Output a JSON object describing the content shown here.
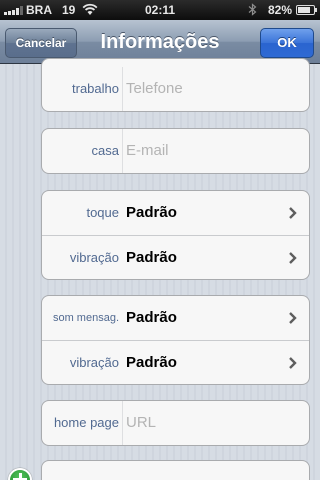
{
  "status_bar": {
    "carrier": "BRA",
    "network": "19",
    "time": "02:11",
    "battery": "82%",
    "battery_level": 0.82
  },
  "nav": {
    "title": "Informações",
    "cancel_label": "Cancelar",
    "ok_label": "OK"
  },
  "fields": {
    "work_phone": {
      "label": "trabalho",
      "placeholder": "Telefone"
    },
    "home_email": {
      "label": "casa",
      "placeholder": "E-mail"
    },
    "ringtone": {
      "label": "toque",
      "value": "Padrão"
    },
    "ring_vibration": {
      "label": "vibração",
      "value": "Padrão"
    },
    "text_tone": {
      "label": "som mensag.",
      "value": "Padrão"
    },
    "text_vibration": {
      "label": "vibração",
      "value": "Padrão"
    },
    "homepage": {
      "label": "home page",
      "placeholder": "URL"
    }
  },
  "icons": [
    "signal-icon",
    "wifi-icon",
    "bluetooth-icon",
    "battery-icon",
    "chevron-right-icon",
    "add-icon"
  ]
}
